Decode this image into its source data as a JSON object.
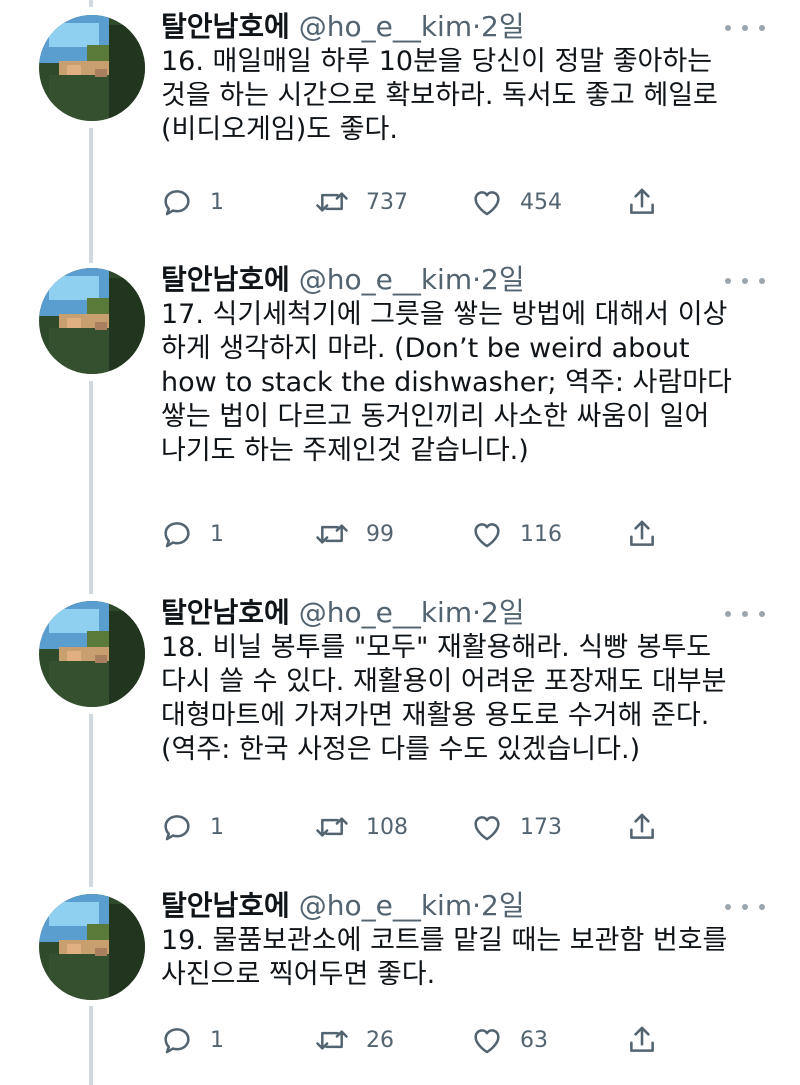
{
  "colors": {
    "text": "#0f1419",
    "secondary": "#536471",
    "thread_line": "#cfd9de",
    "icon": "#536471"
  },
  "icons": {
    "reply": "speech-bubble-icon",
    "retweet": "retweet-arrows-icon",
    "like": "heart-icon",
    "share": "share-upload-icon",
    "more": "ellipsis-icon"
  },
  "tweets": [
    {
      "author_name": "탈안남호에",
      "author_handle": "@ho_e__kim",
      "separator": "·",
      "time": "2일",
      "text": "16. 매일매일 하루 10분을 당신이 정말 좋아하는\n것을 하는 시간으로 확보하라. 독서도 좋고 헤일로\n(비디오게임)도 좋다.",
      "replies": "1",
      "retweets": "737",
      "likes": "454"
    },
    {
      "author_name": "탈안남호에",
      "author_handle": "@ho_e__kim",
      "separator": "·",
      "time": "2일",
      "text": "17. 식기세척기에 그릇을 쌓는 방법에 대해서 이상\n하게 생각하지 마라. (Don’t be weird about\nhow to stack the dishwasher; 역주: 사람마다\n쌓는 법이 다르고 동거인끼리 사소한 싸움이 일어\n나기도 하는 주제인것 같습니다.)",
      "replies": "1",
      "retweets": "99",
      "likes": "116"
    },
    {
      "author_name": "탈안남호에",
      "author_handle": "@ho_e__kim",
      "separator": "·",
      "time": "2일",
      "text": "18. 비닐 봉투를 \"모두\" 재활용해라. 식빵 봉투도\n다시 쓸 수 있다. 재활용이 어려운 포장재도 대부분\n대형마트에 가져가면 재활용 용도로 수거해 준다.\n(역주: 한국 사정은 다를 수도 있겠습니다.)",
      "replies": "1",
      "retweets": "108",
      "likes": "173"
    },
    {
      "author_name": "탈안남호에",
      "author_handle": "@ho_e__kim",
      "separator": "·",
      "time": "2일",
      "text": "19. 물품보관소에 코트를 맡길 때는 보관함 번호를\n사진으로 찍어두면 좋다.",
      "replies": "1",
      "retweets": "26",
      "likes": "63"
    }
  ]
}
